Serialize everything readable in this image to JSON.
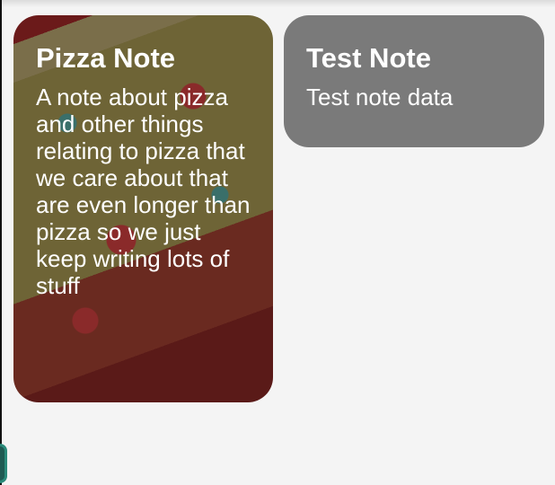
{
  "notes": [
    {
      "title": "Pizza Note",
      "body": "A note about pizza and other things relating to pizza that we care about that are even longer than pizza so we just keep writing lots of stuff",
      "background": "pizza-image"
    },
    {
      "title": "Test Note",
      "body": "Test note data",
      "background": "#7a7a7a"
    }
  ]
}
